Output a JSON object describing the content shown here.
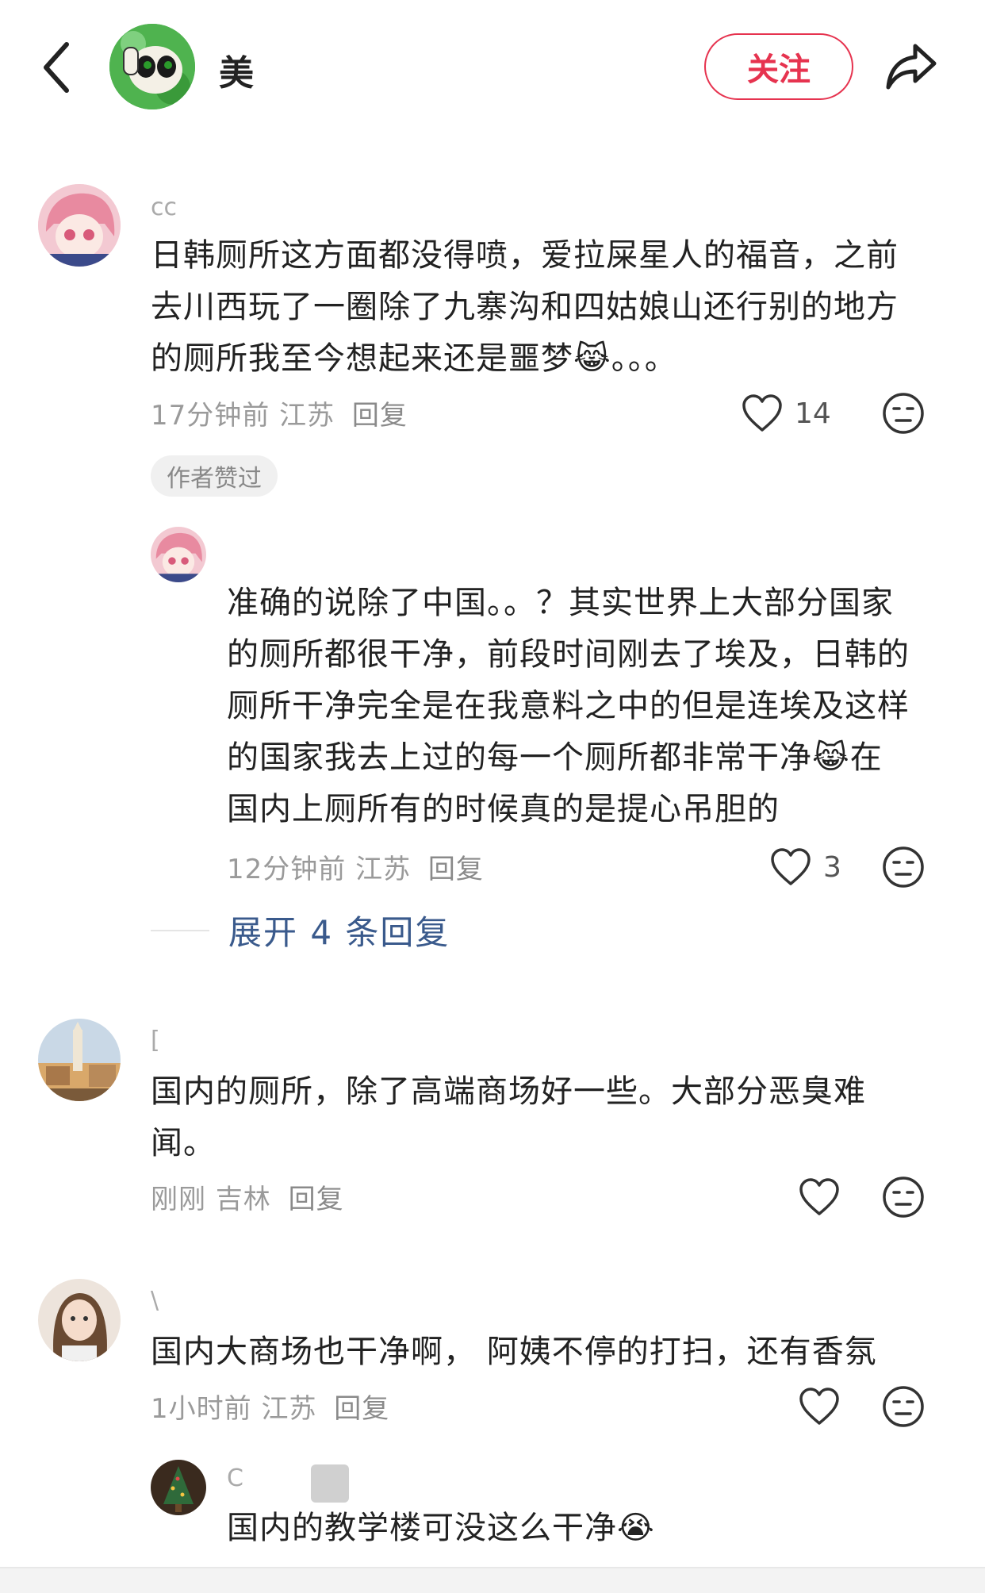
{
  "header": {
    "user_name": "美",
    "follow_label": "关注"
  },
  "comments": [
    {
      "user": "cc",
      "text": "日韩厕所这方面都没得喷，爱拉屎星人的福音，之前去川西玩了一圈除了九寨沟和四姑娘山还行别的地方的厕所我至今想起来还是噩梦",
      "text_lines": [
        "日韩厕所这方面都没得喷，爱拉屎星人的福音，之前",
        "去川西玩了一圈除了九寨沟和四姑娘山还行别的地方",
        "的厕所我至今想起来还是噩梦"
      ],
      "text_tail": "。。。",
      "time": "17分钟前",
      "location": "江苏",
      "reply_label": "回复",
      "likes": "14",
      "author_liked_badge": "作者赞过"
    },
    {
      "user": "",
      "text_lines": [
        "准确的说除了中国。。？其实世界上大部分国家",
        "的厕所都很干净，前段时间刚去了埃及，日韩的",
        "厕所干净完全是在我意料之中的但是连埃及这样",
        "的国家我去上过的每一个厕所都非常干净",
        "国内上厕所有的时候真的是提心吊胆的"
      ],
      "line4_tail": "在",
      "time": "12分钟前",
      "location": "江苏",
      "reply_label": "回复",
      "likes": "3"
    },
    {
      "expand_label": "展开 4 条回复"
    },
    {
      "user": "[",
      "text_lines": [
        "国内的厕所，除了高端商场好一些。大部分恶臭难",
        "闻。"
      ],
      "time": "刚刚",
      "location": "吉林",
      "reply_label": "回复",
      "likes": ""
    },
    {
      "user": "\\",
      "text_lines": [
        "国内大商场也干净啊， 阿姨不停的打扫，还有香氛"
      ],
      "time": "1小时前",
      "location": "江苏",
      "reply_label": "回复",
      "likes": ""
    },
    {
      "user": "C",
      "text_lines": [
        "国内的教学楼可没这么干净"
      ]
    }
  ],
  "colors": {
    "accent_red": "#e6334f",
    "link_blue": "#3a5a8c",
    "meta_gray": "#9a9a9a"
  },
  "icons": [
    "back-arrow-icon",
    "share-icon",
    "heart-icon",
    "neutral-face-icon",
    "cat-crying-emoji",
    "crying-emoji"
  ]
}
